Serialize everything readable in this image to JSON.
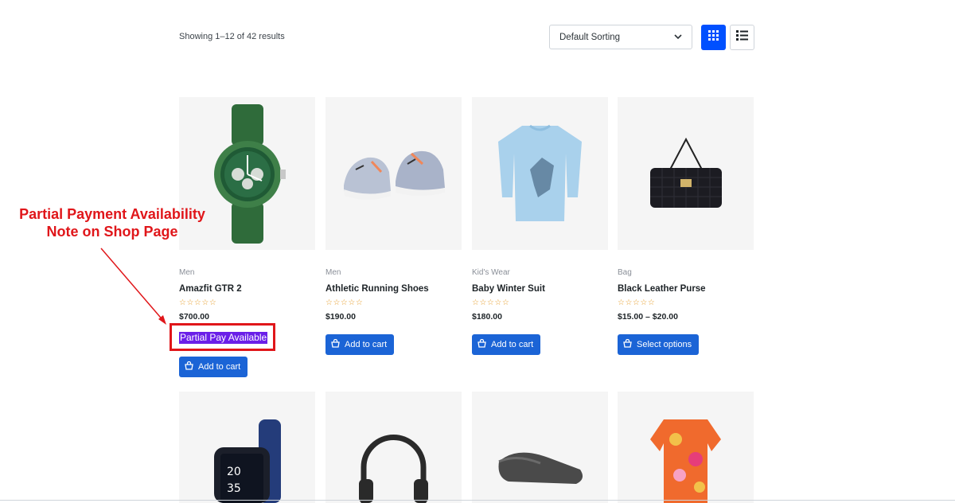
{
  "toolbar": {
    "results_text": "Showing 1–12 of 42 results",
    "sort_value": "Default Sorting"
  },
  "products": [
    {
      "category": "Men",
      "name": "Amazfit GTR 2",
      "price": "$700.00",
      "rating_stars": "☆☆☆☆☆",
      "partial_note": "Partial Pay Available",
      "button": "Add to cart"
    },
    {
      "category": "Men",
      "name": "Athletic Running Shoes",
      "price": "$190.00",
      "rating_stars": "☆☆☆☆☆",
      "button": "Add to cart"
    },
    {
      "category": "Kid's Wear",
      "name": "Baby Winter Suit",
      "price": "$180.00",
      "rating_stars": "☆☆☆☆☆",
      "button": "Add to cart"
    },
    {
      "category": "Bag",
      "name": "Black Leather Purse",
      "price": "$15.00 – $20.00",
      "rating_stars": "☆☆☆☆☆",
      "button": "Select options"
    }
  ],
  "annotation": {
    "line1": "Partial Payment Availability",
    "line2": "Note on Shop Page"
  },
  "colors": {
    "accent": "#1b64d6",
    "view_active": "#0050ff",
    "partial_highlight": "#6a1fe8",
    "annotation_red": "#e0161a"
  },
  "icons": [
    "chevron-down-icon",
    "grid-view-icon",
    "list-view-icon",
    "cart-basket-icon",
    "star-icon"
  ]
}
